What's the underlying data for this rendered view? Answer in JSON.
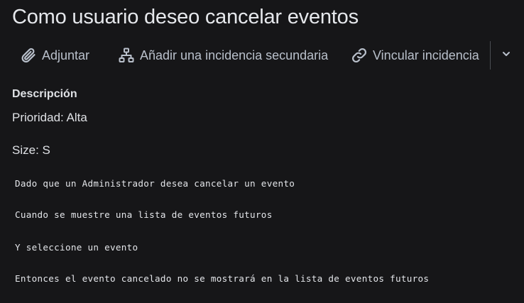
{
  "issue": {
    "title": "Como usuario deseo cancelar eventos"
  },
  "toolbar": {
    "attach_label": "Adjuntar",
    "add_child_label": "Añadir una incidencia secundaria",
    "link_label": "Vincular incidencia",
    "attach_icon": "paperclip-icon",
    "add_child_icon": "hierarchy-icon",
    "link_icon": "link-icon",
    "more_icon": "chevron-down-icon"
  },
  "description": {
    "heading": "Descripción",
    "priority": "Prioridad: Alta",
    "size": "Size: S",
    "code_lines": [
      "Dado que un Administrador desea cancelar un evento",
      "Cuando se muestre una lista de eventos futuros",
      "Y seleccione un evento",
      "Entonces el evento cancelado no se mostrará en la lista de eventos futuros"
    ]
  },
  "colors": {
    "background": "#161618",
    "text": "#dfe1e5",
    "toolbar_text": "#b9c0cb"
  }
}
